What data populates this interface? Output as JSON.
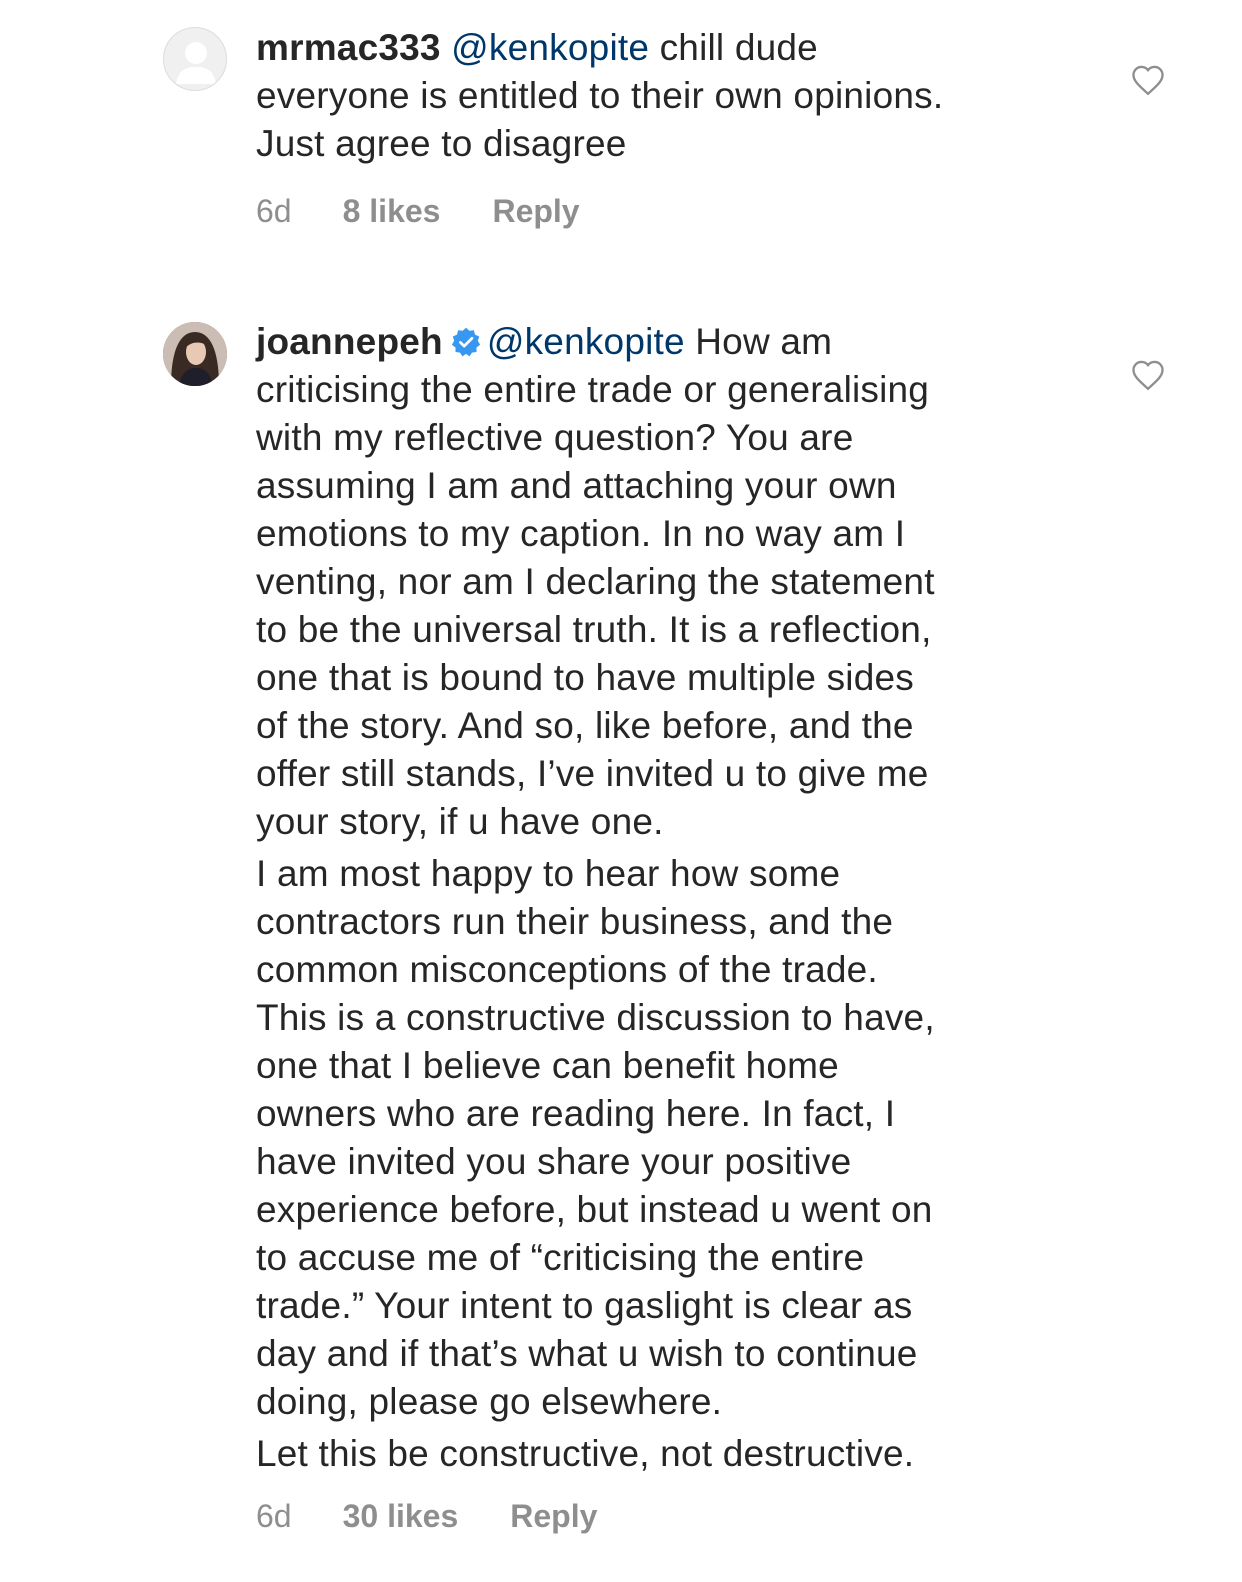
{
  "comments": [
    {
      "username": "mrmac333",
      "verified": false,
      "mention": "@kenkopite",
      "paragraphs": [
        "chill dude\neveryone is entitled to their own opinions.\nJust agree to disagree"
      ],
      "time": "6d",
      "likes": "8 likes",
      "reply_label": "Reply",
      "like_icon": "heart-outline-icon"
    },
    {
      "username": "joannepeh",
      "verified": true,
      "mention": "@kenkopite",
      "paragraphs": [
        "How am\ncriticising the entire trade or generalising\nwith my reflective question? You are\nassuming I am and attaching your own\nemotions to my caption. In no way am I\nventing, nor am I declaring the statement\nto be the universal truth. It is a reflection,\none that is bound to have multiple sides\nof the story. And so, like before, and the\noffer still stands, I’ve invited u to give me\nyour story, if u have one.",
        "I am most happy to hear how some\ncontractors run their business, and the\ncommon misconceptions of the trade.\nThis is a constructive discussion to have,\none that I believe can benefit home\nowners who are reading here. In fact, I\nhave invited you share your positive\nexperience before, but instead u went on\nto accuse me of “criticising the entire\ntrade.” Your intent to gaslight is clear as\nday and if that’s what u wish to continue\ndoing, please go elsewhere.",
        "Let this be constructive, not destructive."
      ],
      "time": "6d",
      "likes": "30 likes",
      "reply_label": "Reply",
      "like_icon": "heart-outline-icon"
    }
  ],
  "colors": {
    "text": "#262626",
    "mention": "#00376b",
    "meta": "#8e8e8e",
    "verified": "#3897f0"
  }
}
